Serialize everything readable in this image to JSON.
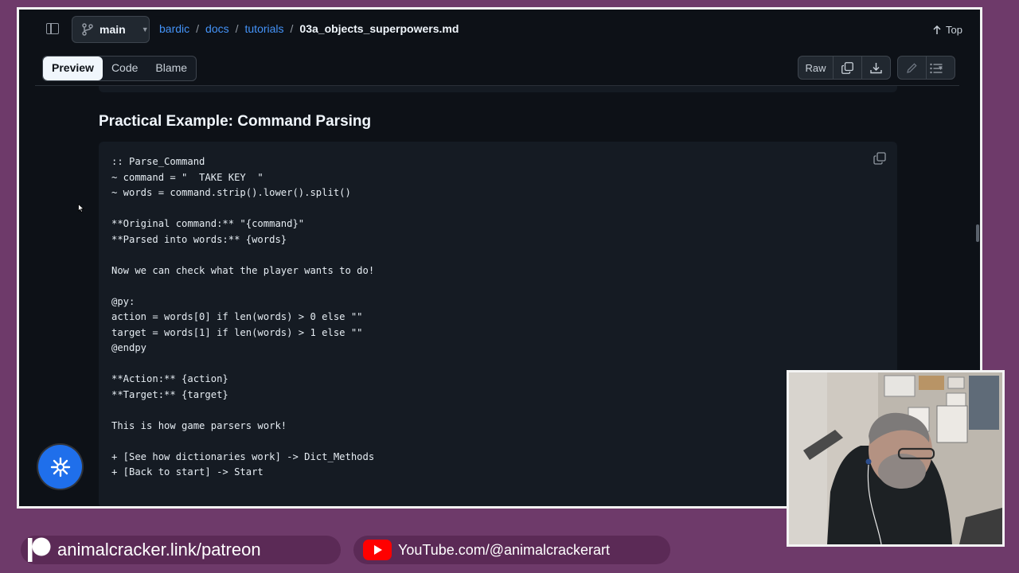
{
  "header": {
    "branch": "main",
    "breadcrumb": [
      {
        "label": "bardic",
        "link": true
      },
      {
        "label": "docs",
        "link": true
      },
      {
        "label": "tutorials",
        "link": true
      },
      {
        "label": "03a_objects_superpowers.md",
        "link": false
      }
    ],
    "separator": "/",
    "top_label": "Top"
  },
  "toolbar": {
    "tabs": [
      {
        "label": "Preview",
        "active": true
      },
      {
        "label": "Code",
        "active": false
      },
      {
        "label": "Blame",
        "active": false
      }
    ],
    "raw_label": "Raw"
  },
  "content": {
    "heading": "Practical Example: Command Parsing",
    "code": ":: Parse_Command\n~ command = \"  TAKE KEY  \"\n~ words = command.strip().lower().split()\n\n**Original command:** \"{command}\"\n**Parsed into words:** {words}\n\nNow we can check what the player wants to do!\n\n@py:\naction = words[0] if len(words) > 0 else \"\"\ntarget = words[1] if len(words) > 1 else \"\"\n@endpy\n\n**Action:** {action}\n**Target:** {target}\n\nThis is how game parsers work!\n\n+ [See how dictionaries work] -> Dict_Methods\n+ [Back to start] -> Start"
  },
  "overlay": {
    "patreon_text": "animalcracker.link/patreon",
    "youtube_text": "YouTube.com/@animalcrackerart"
  },
  "colors": {
    "page_bg": "#0d1117",
    "link": "#4493f8",
    "fab": "#1f6feb",
    "stream_bg": "#6e3a6a",
    "youtube_red": "#ff0000"
  }
}
